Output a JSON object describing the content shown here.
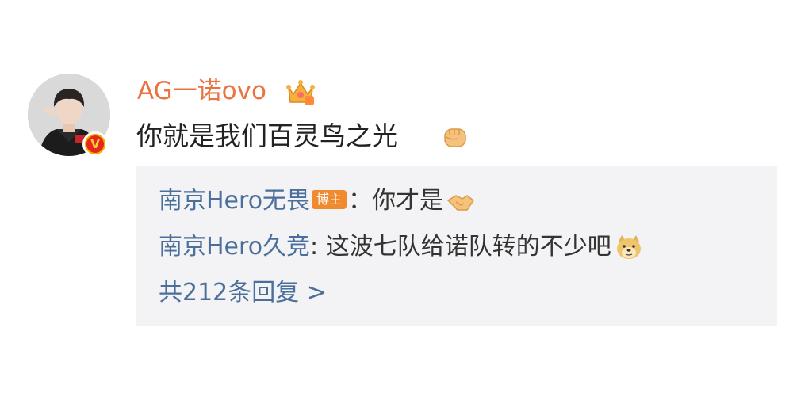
{
  "comment": {
    "user_name": "AG一诺ovo",
    "verified_mark": "V",
    "text": "你就是我们百灵鸟之光",
    "crown_icon": "crown-icon",
    "text_emoji": "fist-icon"
  },
  "replies": [
    {
      "author": "南京Hero无畏",
      "badge": "博主",
      "separator": "：",
      "text": "你才是",
      "emoji": "handshake-icon"
    },
    {
      "author": "南京Hero久竞",
      "separator": ": ",
      "text": "这波七队给诺队转的不少吧",
      "emoji": "doge-icon"
    }
  ],
  "reply_count_label": "共212条回复 >",
  "colors": {
    "user_name": "#eb7340",
    "reply_author": "#4b6f9b",
    "reply_box_bg": "#f3f3f5",
    "host_badge": "#ef8a2e"
  }
}
